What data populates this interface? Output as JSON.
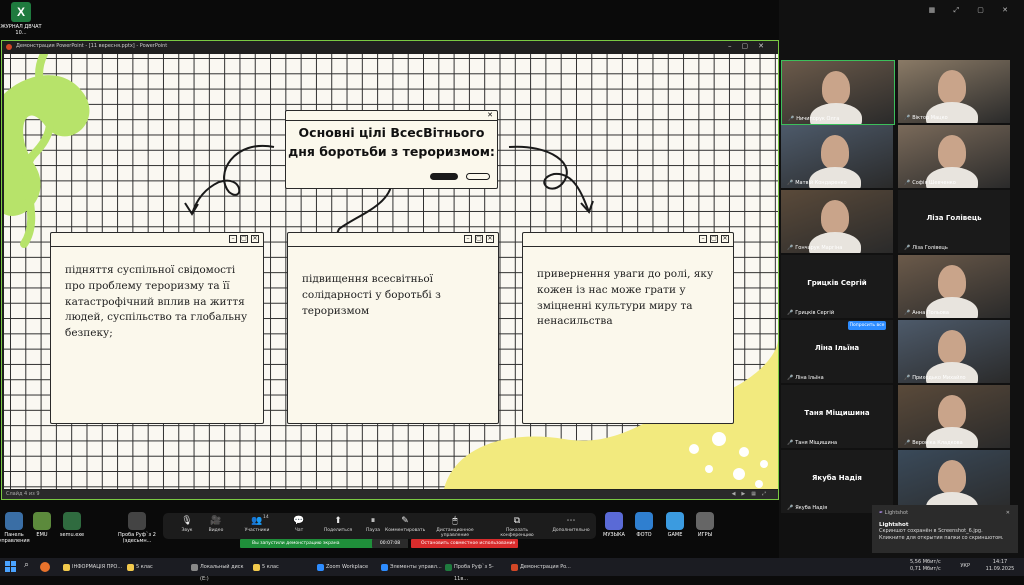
{
  "desktop": {
    "icon_label": "ЖУРНАЛ ДВЧАТ 10..."
  },
  "powerpoint": {
    "window_title": "Демонстрация PowerPoint - [11 вересня.pptx] - PowerPoint",
    "status_left": "Слайд 4 из 9"
  },
  "slide": {
    "title": "Основні цілі ВсесВітнього дня боротьби з тероризмом:",
    "cards": [
      {
        "text": "підняття суспільної свідомості про проблему тероризму та її катастрофічний вплив на життя людей, суспільство та глобальну безпеку;"
      },
      {
        "text": "підвищення всесвітньої солідарності у боротьбі з тероризмом"
      },
      {
        "text": "привернення уваги до ролі, яку кожен із нас може грати у зміцненні культури миру та ненасильства"
      }
    ]
  },
  "zoom_toolbar": {
    "items": [
      {
        "icon": "mic-icon",
        "label": "Звук",
        "glyph": "🎙"
      },
      {
        "icon": "video-icon",
        "label": "Видео",
        "glyph": "🎥"
      },
      {
        "icon": "participants-icon",
        "label": "Участники",
        "glyph": "👥",
        "count": "14"
      },
      {
        "icon": "chat-icon",
        "label": "Чат",
        "glyph": "💬"
      },
      {
        "icon": "share-icon",
        "label": "Поделиться",
        "glyph": "⬆"
      },
      {
        "icon": "pause-icon",
        "label": "Пауза",
        "glyph": "⏸"
      },
      {
        "icon": "annotate-icon",
        "label": "Комментировать",
        "glyph": "✎"
      },
      {
        "icon": "remote-control-icon",
        "label": "Дистанционное управление",
        "glyph": "🖱"
      },
      {
        "icon": "show-captions-icon",
        "label": "Показать конференцию",
        "glyph": "⧉"
      },
      {
        "icon": "more-icon",
        "label": "Дополнительно",
        "glyph": "⋯"
      }
    ],
    "sharing_status": "Вы запустили демонстрацию экрана",
    "timer": "00:07:08",
    "stop_label": "Остановить совместное использование"
  },
  "dock": {
    "left": [
      {
        "label": "Панель управления",
        "color": "#3a6ea5"
      },
      {
        "label": "EMU",
        "color": "#5c8a3c"
      },
      {
        "label": "semu.exe",
        "color": "#2f6b3f"
      },
      {
        "label": "Проба Руф`з 2 (эдесьмн...",
        "color": "#444444"
      }
    ],
    "right": [
      {
        "label": "МУЗЫКА",
        "color": "#5a6ad6"
      },
      {
        "label": "ФОТО",
        "color": "#2f7fd0"
      },
      {
        "label": "GAME",
        "color": "#3b9be0"
      },
      {
        "label": "ИГРЫ",
        "color": "#666666"
      }
    ]
  },
  "participants": [
    {
      "name": "Ничипорук Олга",
      "video": true
    },
    {
      "name": "Віктор Мацко",
      "video": true
    },
    {
      "name": "Матвій Кондаренко",
      "video": true
    },
    {
      "name": "Софія Шевченко",
      "video": true
    },
    {
      "name": "Гончарук Маргіна",
      "video": true
    },
    {
      "name": "Ліза Голівець",
      "video": false,
      "big": "Ліза Голівець"
    },
    {
      "name": "Грицків Сергій",
      "video": false,
      "big": "Грицків Сергій"
    },
    {
      "name": "Анна Польова",
      "video": true
    },
    {
      "name": "Ліна Ільїна",
      "video": false,
      "big": "Ліна Ільїна"
    },
    {
      "name": "Приходько Михайло",
      "video": true
    },
    {
      "name": "Таня Міщишина",
      "video": false,
      "big": "Таня Міщишина"
    },
    {
      "name": "Вероніка Кладкова",
      "video": true
    },
    {
      "name": "Якуба Надія",
      "video": false,
      "big": "Якуба Надія"
    },
    {
      "name": "",
      "video": true
    }
  ],
  "ask_button": "Попросить все",
  "toast": {
    "app": "Lightshot",
    "title": "Lightshot",
    "line1": "Скриншот сохранён в Screenshot_6.jpg.",
    "line2": "Кликните для открытия папки со скриншотом."
  },
  "taskbar": {
    "items": [
      {
        "label": "ІНФОРМАЦІЯ ПРО...",
        "color": "#f2c94c"
      },
      {
        "label": "5 клас",
        "color": "#f2c94c"
      },
      {
        "label": "Локальный диск (E:)",
        "color": "#888888"
      },
      {
        "label": "5 клас",
        "color": "#f2c94c"
      },
      {
        "label": "Zoom Workplace",
        "color": "#2d8cff"
      },
      {
        "label": "Элементы управл...",
        "color": "#2d8cff"
      },
      {
        "label": "Проба Руф`з 5-11в...",
        "color": "#1f7a3e"
      },
      {
        "label": "Демонстрация Po...",
        "color": "#d24726"
      }
    ],
    "net_up": "5,56 Мбит/с",
    "net_down": "0,71 Мбит/с",
    "lang": "УКР",
    "time": "14:17",
    "date": "11.09.2025"
  }
}
